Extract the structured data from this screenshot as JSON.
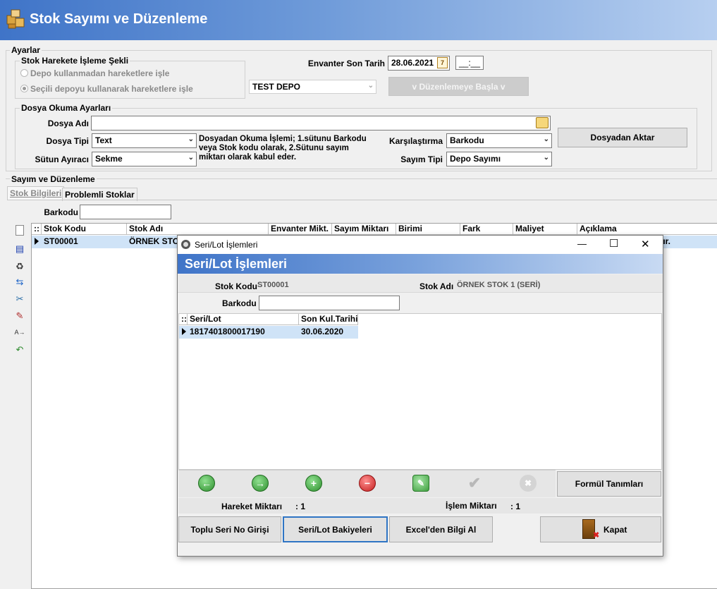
{
  "app": {
    "title": "Stok Sayımı ve Düzenleme"
  },
  "settings": {
    "legend": "Ayarlar",
    "processing_group": {
      "legend": "Stok Harekete İşleme Şekli",
      "option1": "Depo kullanmadan hareketlere işle",
      "option2": "Seçili depoyu kullanarak hareketlere işle",
      "selected": "option2"
    },
    "inventory_last_date_label": "Envanter Son Tarih",
    "inventory_last_date": "28.06.2021",
    "calendar_day": "7",
    "time_value": "__:__",
    "depot": "TEST DEPO",
    "start_button": "v Düzenlemeye Başla v"
  },
  "file_settings": {
    "legend": "Dosya Okuma Ayarları",
    "file_name_label": "Dosya Adı",
    "file_name": "",
    "file_type_label": "Dosya Tipi",
    "file_type": "Text",
    "separator_label": "Sütun Ayıracı",
    "separator": "Sekme",
    "info_text": "Dosyadan Okuma İşlemi; 1.sütunu Barkodu veya Stok kodu olarak, 2.Sütunu sayım miktarı olarak kabul eder.",
    "compare_label": "Karşılaştırma",
    "compare": "Barkodu",
    "count_type_label": "Sayım Tipi",
    "count_type": "Depo Sayımı",
    "import_button": "Dosyadan Aktar"
  },
  "count_section": {
    "legend": "Sayım ve Düzenleme",
    "tabs": [
      "Stok Bilgileri",
      "Problemli Stoklar"
    ],
    "barcode_label": "Barkodu",
    "barcode": "",
    "columns": [
      "::",
      "Stok Kodu",
      "Stok Adı",
      "Envanter Mikt.",
      "Sayım Miktarı",
      "Birimi",
      "Fark",
      "Maliyet",
      "Açıklama"
    ],
    "rows": [
      {
        "code": "ST00001",
        "name": "ÖRNEK STOK",
        "tail": "ıtır."
      }
    ]
  },
  "dialog": {
    "window_title": "Seri/Lot İşlemleri",
    "header": "Seri/Lot İşlemleri",
    "stock_code_label": "Stok Kodu",
    "stock_code": "ST00001",
    "stock_name_label": "Stok Adı",
    "stock_name": "ÖRNEK STOK 1 (SERİ)",
    "barcode_label": "Barkodu",
    "barcode": "",
    "columns": [
      "::",
      "Seri/Lot",
      "Son Kul.Tarihi"
    ],
    "rows": [
      {
        "serial": "1817401800017190",
        "date": "30.06.2020"
      }
    ],
    "formula_button": "Formül Tanımları",
    "movement_qty_label": "Hareket Miktarı",
    "movement_qty": ": 1",
    "process_qty_label": "İşlem Miktarı",
    "process_qty": ": 1",
    "bulk_serial_button": "Toplu Seri No Girişi",
    "balances_button": "Seri/Lot Bakiyeleri",
    "excel_button": "Excel'den Bilgi Al",
    "close_button": "Kapat",
    "window_controls": {
      "minimize": "—",
      "maximize": "☐",
      "close": "✕"
    }
  },
  "colors": {
    "header_blue": "#3f74c8",
    "selected_row": "#cfe3f7",
    "nav_green": "#3aa13a",
    "nav_red": "#d62b2b"
  }
}
